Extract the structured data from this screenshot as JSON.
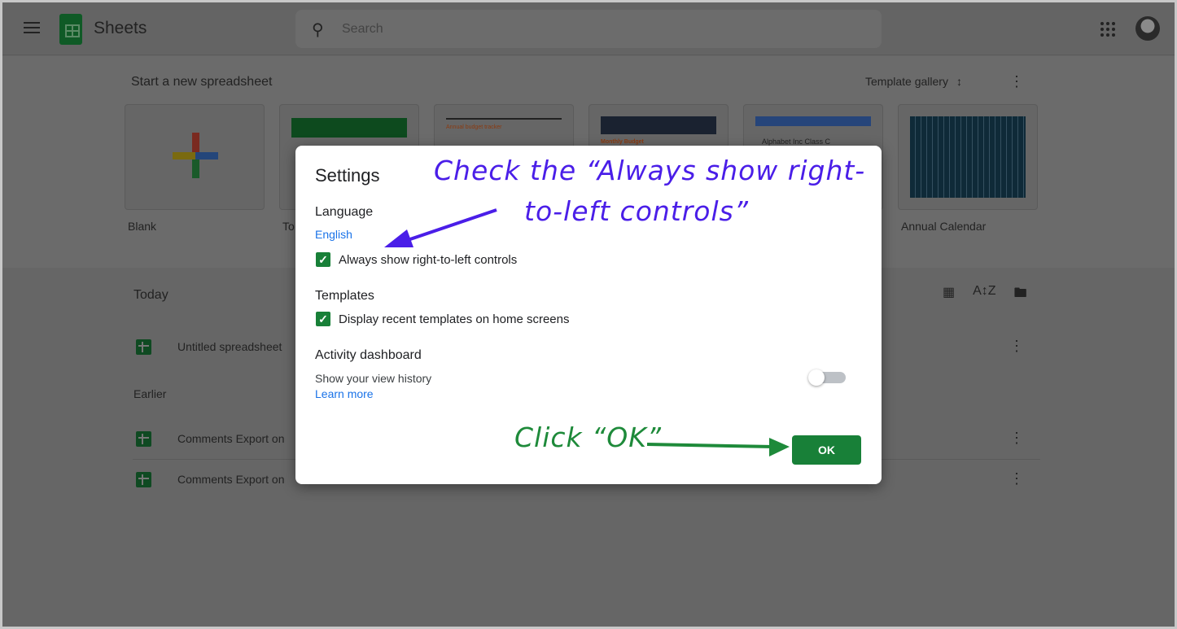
{
  "header": {
    "app_title": "Sheets",
    "search_placeholder": "Search"
  },
  "templates": {
    "section_title": "Start a new spreadsheet",
    "gallery_label": "Template gallery",
    "cards": [
      {
        "label": "Blank"
      },
      {
        "label": "To Do"
      },
      {
        "label": "Annual budget tracker"
      },
      {
        "label": "Monthly Budget"
      },
      {
        "label": "Alphabet Inc Class C"
      },
      {
        "label": "Annual Calendar"
      }
    ]
  },
  "files": {
    "today_heading": "Today",
    "earlier_heading": "Earlier",
    "today": [
      {
        "name": "Untitled spreadsheet"
      }
    ],
    "earlier": [
      {
        "name": "Comments Export on"
      },
      {
        "name": "Comments Export on"
      }
    ]
  },
  "dialog": {
    "title": "Settings",
    "language_heading": "Language",
    "language_value": "English",
    "rtl_label": "Always show right-to-left controls",
    "rtl_checked": true,
    "templates_heading": "Templates",
    "templates_label": "Display recent templates on home screens",
    "templates_checked": true,
    "activity_heading": "Activity dashboard",
    "activity_desc": "Show your view history",
    "learn_more": "Learn more",
    "activity_enabled": false,
    "ok_label": "OK"
  },
  "annotations": {
    "top_line1": "Check the “Always show right-",
    "top_line2": "to-left controls”",
    "bottom": "Click “OK”",
    "top_color": "#4a1ee8",
    "bottom_color": "#1e8a3a"
  }
}
